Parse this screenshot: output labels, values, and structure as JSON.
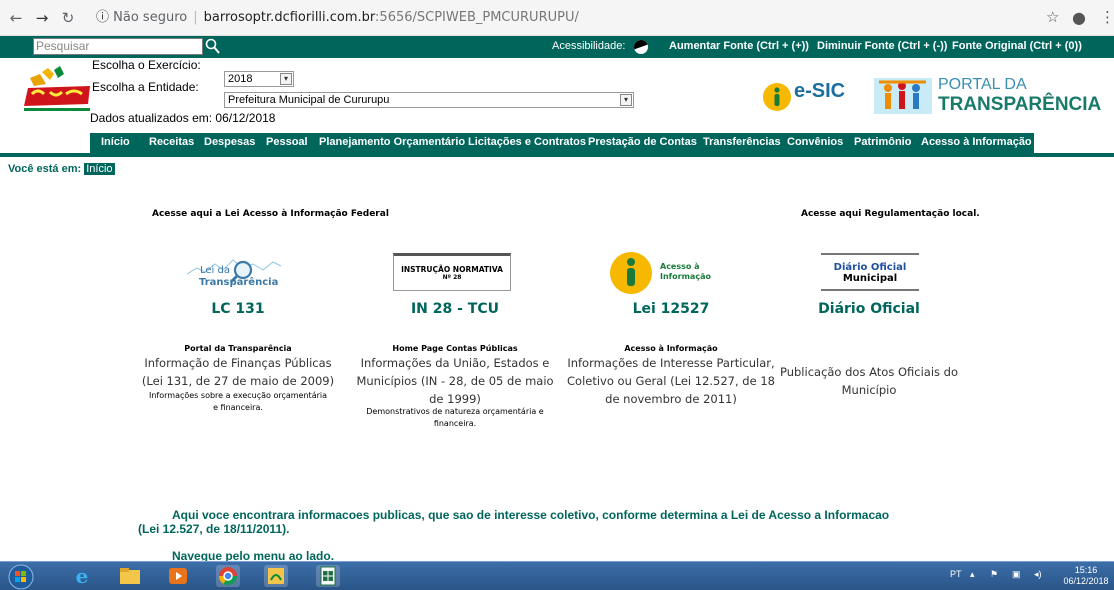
{
  "browser": {
    "secure_label": "Não seguro",
    "url_host": "barrosoptr.dcfiorilli.com.br",
    "url_path": ":5656/SCPIWEB_PMCURURUPU/"
  },
  "topbar": {
    "search_placeholder": "Pesquisar",
    "accessibility": "Acessibilidade:",
    "increase_font": "Aumentar Fonte (Ctrl + (+))",
    "decrease_font": "Diminuir Fonte (Ctrl + (-))",
    "original_font": "Fonte Original (Ctrl + (0))"
  },
  "header": {
    "logo_text": "Cururupu",
    "exercise_label": "Escolha o Exercício:",
    "exercise_value": "2018",
    "entity_label": "Escolha a Entidade:",
    "entity_value": "Prefeitura Municipal de Cururupu",
    "updated": "Dados atualizados em: 06/12/2018",
    "esic_label": "e-SIC",
    "portal_line1": "PORTAL DA",
    "portal_line2": "TRANSPARÊNCIA"
  },
  "menu": [
    "Início",
    "Receitas",
    "Despesas",
    "Pessoal",
    "Planejamento Orçamentário",
    "Licitações e Contratos",
    "Prestação de Contas",
    "Transferências",
    "Convênios",
    "Patrimônio",
    "Acesso à Informação"
  ],
  "breadcrumb": {
    "label": "Você está em:",
    "current": "Início"
  },
  "content": {
    "lead_federal": "Acesse aqui a Lei Acesso à Informação Federal",
    "lead_local": "Acesse aqui Regulamentação local.",
    "cards": [
      {
        "img_line1": "Lei da",
        "img_line2": "Transparência",
        "title": "LC 131",
        "sub": "Portal da Transparência",
        "body": "Informação de Finanças Públicas (Lei 131, de 27 de maio de 2009)",
        "note": "Informações sobre a execução orçamentária e financeira."
      },
      {
        "img_line1": "INSTRUÇÃO NORMATIVA",
        "img_line2": "Nº 28",
        "title": "IN 28 - TCU",
        "sub": "Home Page Contas Públicas",
        "body": "Informações da União, Estados e Municípios (IN - 28, de 05 de maio de 1999)",
        "note": "Demonstrativos de natureza orçamentária e financeira."
      },
      {
        "img_line1": "Acesso à",
        "img_line2": "Informação",
        "title": "Lei 12527",
        "sub": "Acesso à Informação",
        "body": "Informações de Interesse Particular, Coletivo ou Geral (Lei 12.527, de 18 de novembro de 2011)",
        "note": ""
      },
      {
        "img_line1": "Diário Oficial",
        "img_line2": "Municipal",
        "title": "Diário Oficial",
        "sub": "",
        "body": "Publicação dos Atos Oficiais do Município",
        "note": ""
      }
    ],
    "bottom_text_1": "Aqui voce encontrara informacoes publicas, que sao de interesse coletivo, conforme determina a Lei de Acesso a Informacao",
    "bottom_text_2": "(Lei 12.527, de 18/11/2011).",
    "nav_hint": "Navegue pelo menu ao lado."
  },
  "taskbar": {
    "lang": "PT",
    "time": "15:16",
    "date": "06/12/2018"
  },
  "colors": {
    "brand_green": "#00665c",
    "taskbar_blue": "#2a5588"
  }
}
